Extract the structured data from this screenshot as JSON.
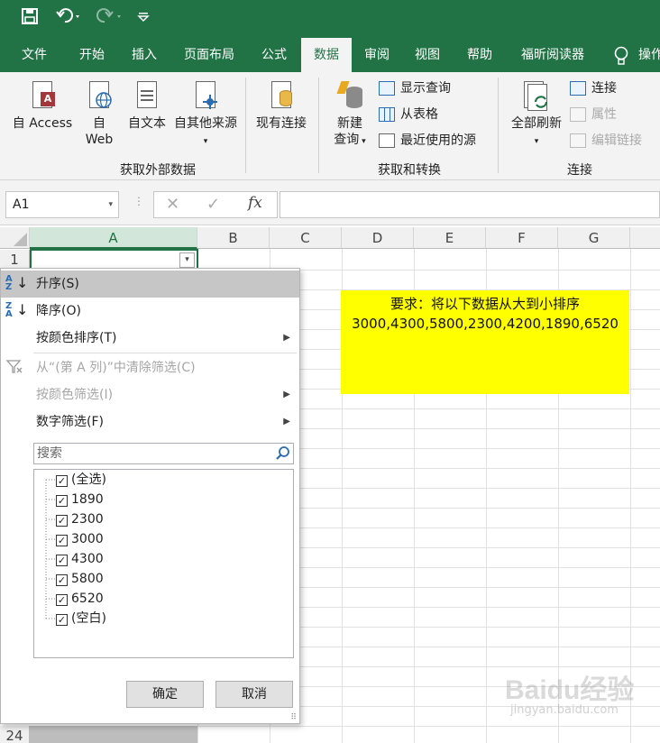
{
  "quick_access": [
    "save-icon",
    "undo-icon",
    "redo-icon",
    "customize-icon"
  ],
  "tabs": [
    "文件",
    "开始",
    "插入",
    "页面布局",
    "公式",
    "数据",
    "审阅",
    "视图",
    "帮助",
    "福昕阅读器",
    "操作"
  ],
  "active_tab": "数据",
  "ribbon": {
    "access": "自 Access",
    "web_1": "自",
    "web_2": "Web",
    "text": "自文本",
    "other": "自其他来源",
    "existing": "现有连接",
    "group1": "获取外部数据",
    "newquery_1": "新建",
    "newquery_2": "查询",
    "showquery": "显示查询",
    "fromtable": "从表格",
    "recent": "最近使用的源",
    "group2": "获取和转换",
    "refresh": "全部刷新",
    "connections": "连接",
    "properties": "属性",
    "editlinks": "编辑链接",
    "group3": "连接"
  },
  "formula_bar": {
    "namebox": "A1",
    "fx": "fx"
  },
  "columns": [
    "A",
    "B",
    "C",
    "D",
    "E",
    "F",
    "G"
  ],
  "rows": {
    "first": "1",
    "last": "24"
  },
  "note": {
    "line1": "要求：将以下数据从大到小排序",
    "line2": "3000,4300,5800,2300,4200,1890,6520"
  },
  "filter_menu": {
    "sort_asc": "升序(S)",
    "sort_desc": "降序(O)",
    "sort_color": "按颜色排序(T)",
    "clear": "从“(第 A 列)”中清除筛选(C)",
    "filter_color": "按颜色筛选(I)",
    "number_filter": "数字筛选(F)",
    "search_placeholder": "搜索",
    "items": [
      "(全选)",
      "1890",
      "2300",
      "3000",
      "4300",
      "5800",
      "6520",
      "(空白)"
    ],
    "ok": "确定",
    "cancel": "取消"
  },
  "watermark": {
    "brand": "Baidu经验",
    "url": "jingyan.baidu.com"
  }
}
